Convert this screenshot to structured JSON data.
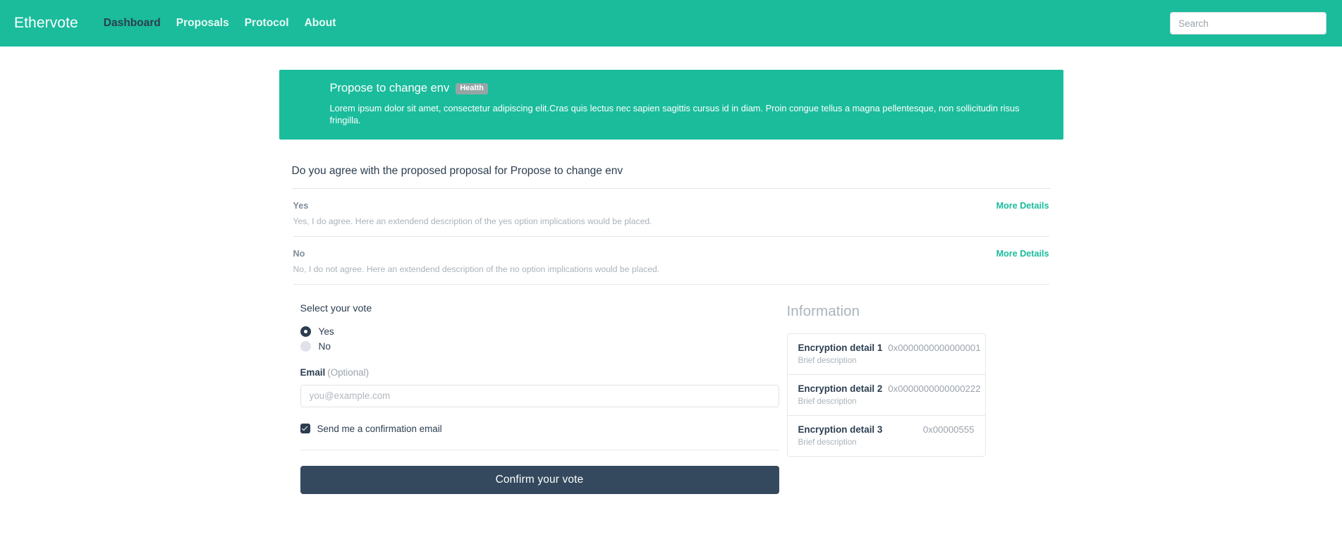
{
  "navbar": {
    "brand": "Ethervote",
    "links": [
      {
        "label": "Dashboard",
        "active": true
      },
      {
        "label": "Proposals",
        "active": false
      },
      {
        "label": "Protocol",
        "active": false
      },
      {
        "label": "About",
        "active": false
      }
    ],
    "search_placeholder": "Search",
    "search_value": "",
    "background_color": "#1abc9c"
  },
  "banner": {
    "title": "Propose to change env",
    "badge": "Health",
    "description": "Lorem ipsum dolor sit amet, consectetur adipiscing elit.Cras quis lectus nec sapien sagittis cursus id in diam. Proin congue tellus a magna pellentesque, non sollicitudin risus fringilla.",
    "background_color": "#1abc9c",
    "badge_color": "#95a5a6"
  },
  "question": {
    "title": "Do you agree with the proposed proposal for Propose to change env",
    "options": [
      {
        "label": "Yes",
        "description": "Yes, I do agree. Here an extendend description of the yes option implications would be placed.",
        "more_details": "More Details"
      },
      {
        "label": "No",
        "description": "No, I do not agree. Here an extendend description of the no option implications would be placed.",
        "more_details": "More Details"
      }
    ]
  },
  "vote_form": {
    "legend": "Select your vote",
    "radios": [
      {
        "label": "Yes",
        "checked": true
      },
      {
        "label": "No",
        "checked": false
      }
    ],
    "email_label": "Email",
    "email_optional": "(Optional)",
    "email_placeholder": "you@example.com",
    "email_value": "",
    "confirmation_checkbox_label": "Send me a confirmation email",
    "confirmation_checkbox_checked": true,
    "submit_label": "Confirm your vote",
    "submit_color": "#34495e"
  },
  "information": {
    "title": "Information",
    "items": [
      {
        "name": "Encryption detail 1",
        "value": "0x0000000000000001",
        "description": "Brief description"
      },
      {
        "name": "Encryption detail 2",
        "value": "0x0000000000000222",
        "description": "Brief description"
      },
      {
        "name": "Encryption detail 3",
        "value": "0x00000555",
        "description": "Brief description"
      }
    ]
  }
}
